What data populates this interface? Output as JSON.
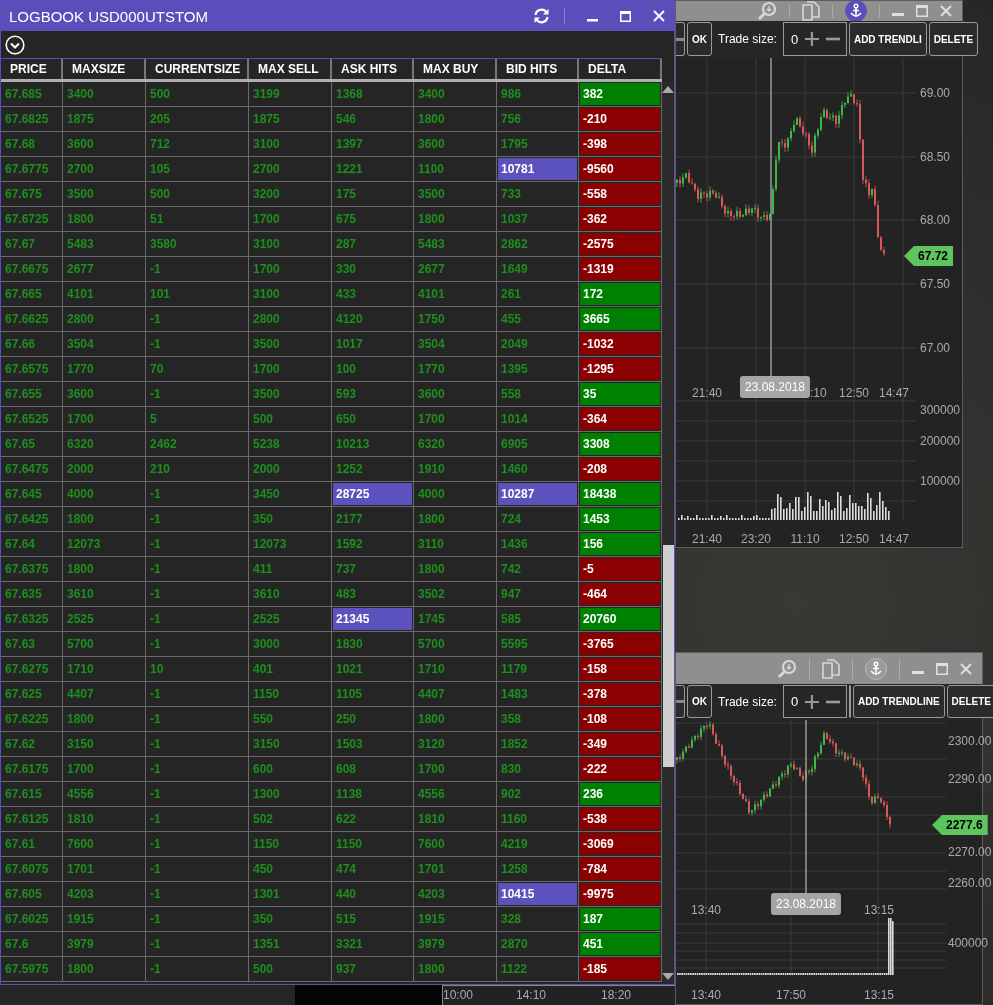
{
  "logbook": {
    "title": "LOGBOOK USD000UTSTOM",
    "columns": [
      "PRICE",
      "MAXSIZE",
      "CURRENTSIZE",
      "MAX SELL",
      "ASK HITS",
      "MAX BUY",
      "BID HITS",
      "DELTA"
    ],
    "rows": [
      {
        "price": "67.685",
        "maxsize": "3400",
        "currentsize": "500",
        "max_sell": "3199",
        "ask_hits": "1368",
        "ask_hits_highlighted": false,
        "max_buy": "3400",
        "bid_hits": "986",
        "bid_hits_highlighted": false,
        "delta": "382",
        "delta_positive": true
      },
      {
        "price": "67.6825",
        "maxsize": "1875",
        "currentsize": "205",
        "max_sell": "1875",
        "ask_hits": "546",
        "ask_hits_highlighted": false,
        "max_buy": "1800",
        "bid_hits": "756",
        "bid_hits_highlighted": false,
        "delta": "-210",
        "delta_positive": false
      },
      {
        "price": "67.68",
        "maxsize": "3600",
        "currentsize": "712",
        "max_sell": "3100",
        "ask_hits": "1397",
        "ask_hits_highlighted": false,
        "max_buy": "3600",
        "bid_hits": "1795",
        "bid_hits_highlighted": false,
        "delta": "-398",
        "delta_positive": false
      },
      {
        "price": "67.6775",
        "maxsize": "2700",
        "currentsize": "105",
        "max_sell": "2700",
        "ask_hits": "1221",
        "ask_hits_highlighted": false,
        "max_buy": "1100",
        "bid_hits": "10781",
        "bid_hits_highlighted": true,
        "delta": "-9560",
        "delta_positive": false
      },
      {
        "price": "67.675",
        "maxsize": "3500",
        "currentsize": "500",
        "max_sell": "3200",
        "ask_hits": "175",
        "ask_hits_highlighted": false,
        "max_buy": "3500",
        "bid_hits": "733",
        "bid_hits_highlighted": false,
        "delta": "-558",
        "delta_positive": false
      },
      {
        "price": "67.6725",
        "maxsize": "1800",
        "currentsize": "51",
        "max_sell": "1700",
        "ask_hits": "675",
        "ask_hits_highlighted": false,
        "max_buy": "1800",
        "bid_hits": "1037",
        "bid_hits_highlighted": false,
        "delta": "-362",
        "delta_positive": false
      },
      {
        "price": "67.67",
        "maxsize": "5483",
        "currentsize": "3580",
        "max_sell": "3100",
        "ask_hits": "287",
        "ask_hits_highlighted": false,
        "max_buy": "5483",
        "bid_hits": "2862",
        "bid_hits_highlighted": false,
        "delta": "-2575",
        "delta_positive": false
      },
      {
        "price": "67.6675",
        "maxsize": "2677",
        "currentsize": "-1",
        "max_sell": "1700",
        "ask_hits": "330",
        "ask_hits_highlighted": false,
        "max_buy": "2677",
        "bid_hits": "1649",
        "bid_hits_highlighted": false,
        "delta": "-1319",
        "delta_positive": false
      },
      {
        "price": "67.665",
        "maxsize": "4101",
        "currentsize": "101",
        "max_sell": "3100",
        "ask_hits": "433",
        "ask_hits_highlighted": false,
        "max_buy": "4101",
        "bid_hits": "261",
        "bid_hits_highlighted": false,
        "delta": "172",
        "delta_positive": true
      },
      {
        "price": "67.6625",
        "maxsize": "2800",
        "currentsize": "-1",
        "max_sell": "2800",
        "ask_hits": "4120",
        "ask_hits_highlighted": false,
        "max_buy": "1750",
        "bid_hits": "455",
        "bid_hits_highlighted": false,
        "delta": "3665",
        "delta_positive": true
      },
      {
        "price": "67.66",
        "maxsize": "3504",
        "currentsize": "-1",
        "max_sell": "3500",
        "ask_hits": "1017",
        "ask_hits_highlighted": false,
        "max_buy": "3504",
        "bid_hits": "2049",
        "bid_hits_highlighted": false,
        "delta": "-1032",
        "delta_positive": false
      },
      {
        "price": "67.6575",
        "maxsize": "1770",
        "currentsize": "70",
        "max_sell": "1700",
        "ask_hits": "100",
        "ask_hits_highlighted": false,
        "max_buy": "1770",
        "bid_hits": "1395",
        "bid_hits_highlighted": false,
        "delta": "-1295",
        "delta_positive": false
      },
      {
        "price": "67.655",
        "maxsize": "3600",
        "currentsize": "-1",
        "max_sell": "3500",
        "ask_hits": "593",
        "ask_hits_highlighted": false,
        "max_buy": "3600",
        "bid_hits": "558",
        "bid_hits_highlighted": false,
        "delta": "35",
        "delta_positive": true
      },
      {
        "price": "67.6525",
        "maxsize": "1700",
        "currentsize": "5",
        "max_sell": "500",
        "ask_hits": "650",
        "ask_hits_highlighted": false,
        "max_buy": "1700",
        "bid_hits": "1014",
        "bid_hits_highlighted": false,
        "delta": "-364",
        "delta_positive": false
      },
      {
        "price": "67.65",
        "maxsize": "6320",
        "currentsize": "2462",
        "max_sell": "5238",
        "ask_hits": "10213",
        "ask_hits_highlighted": false,
        "max_buy": "6320",
        "bid_hits": "6905",
        "bid_hits_highlighted": false,
        "delta": "3308",
        "delta_positive": true
      },
      {
        "price": "67.6475",
        "maxsize": "2000",
        "currentsize": "210",
        "max_sell": "2000",
        "ask_hits": "1252",
        "ask_hits_highlighted": false,
        "max_buy": "1910",
        "bid_hits": "1460",
        "bid_hits_highlighted": false,
        "delta": "-208",
        "delta_positive": false
      },
      {
        "price": "67.645",
        "maxsize": "4000",
        "currentsize": "-1",
        "max_sell": "3450",
        "ask_hits": "28725",
        "ask_hits_highlighted": true,
        "max_buy": "4000",
        "bid_hits": "10287",
        "bid_hits_highlighted": true,
        "delta": "18438",
        "delta_positive": true
      },
      {
        "price": "67.6425",
        "maxsize": "1800",
        "currentsize": "-1",
        "max_sell": "350",
        "ask_hits": "2177",
        "ask_hits_highlighted": false,
        "max_buy": "1800",
        "bid_hits": "724",
        "bid_hits_highlighted": false,
        "delta": "1453",
        "delta_positive": true
      },
      {
        "price": "67.64",
        "maxsize": "12073",
        "currentsize": "-1",
        "max_sell": "12073",
        "ask_hits": "1592",
        "ask_hits_highlighted": false,
        "max_buy": "3110",
        "bid_hits": "1436",
        "bid_hits_highlighted": false,
        "delta": "156",
        "delta_positive": true
      },
      {
        "price": "67.6375",
        "maxsize": "1800",
        "currentsize": "-1",
        "max_sell": "411",
        "ask_hits": "737",
        "ask_hits_highlighted": false,
        "max_buy": "1800",
        "bid_hits": "742",
        "bid_hits_highlighted": false,
        "delta": "-5",
        "delta_positive": false
      },
      {
        "price": "67.635",
        "maxsize": "3610",
        "currentsize": "-1",
        "max_sell": "3610",
        "ask_hits": "483",
        "ask_hits_highlighted": false,
        "max_buy": "3502",
        "bid_hits": "947",
        "bid_hits_highlighted": false,
        "delta": "-464",
        "delta_positive": false
      },
      {
        "price": "67.6325",
        "maxsize": "2525",
        "currentsize": "-1",
        "max_sell": "2525",
        "ask_hits": "21345",
        "ask_hits_highlighted": true,
        "max_buy": "1745",
        "bid_hits": "585",
        "bid_hits_highlighted": false,
        "delta": "20760",
        "delta_positive": true
      },
      {
        "price": "67.63",
        "maxsize": "5700",
        "currentsize": "-1",
        "max_sell": "3000",
        "ask_hits": "1830",
        "ask_hits_highlighted": false,
        "max_buy": "5700",
        "bid_hits": "5595",
        "bid_hits_highlighted": false,
        "delta": "-3765",
        "delta_positive": false
      },
      {
        "price": "67.6275",
        "maxsize": "1710",
        "currentsize": "10",
        "max_sell": "401",
        "ask_hits": "1021",
        "ask_hits_highlighted": false,
        "max_buy": "1710",
        "bid_hits": "1179",
        "bid_hits_highlighted": false,
        "delta": "-158",
        "delta_positive": false
      },
      {
        "price": "67.625",
        "maxsize": "4407",
        "currentsize": "-1",
        "max_sell": "1150",
        "ask_hits": "1105",
        "ask_hits_highlighted": false,
        "max_buy": "4407",
        "bid_hits": "1483",
        "bid_hits_highlighted": false,
        "delta": "-378",
        "delta_positive": false
      },
      {
        "price": "67.6225",
        "maxsize": "1800",
        "currentsize": "-1",
        "max_sell": "550",
        "ask_hits": "250",
        "ask_hits_highlighted": false,
        "max_buy": "1800",
        "bid_hits": "358",
        "bid_hits_highlighted": false,
        "delta": "-108",
        "delta_positive": false
      },
      {
        "price": "67.62",
        "maxsize": "3150",
        "currentsize": "-1",
        "max_sell": "3150",
        "ask_hits": "1503",
        "ask_hits_highlighted": false,
        "max_buy": "3120",
        "bid_hits": "1852",
        "bid_hits_highlighted": false,
        "delta": "-349",
        "delta_positive": false
      },
      {
        "price": "67.6175",
        "maxsize": "1700",
        "currentsize": "-1",
        "max_sell": "600",
        "ask_hits": "608",
        "ask_hits_highlighted": false,
        "max_buy": "1700",
        "bid_hits": "830",
        "bid_hits_highlighted": false,
        "delta": "-222",
        "delta_positive": false
      },
      {
        "price": "67.615",
        "maxsize": "4556",
        "currentsize": "-1",
        "max_sell": "1300",
        "ask_hits": "1138",
        "ask_hits_highlighted": false,
        "max_buy": "4556",
        "bid_hits": "902",
        "bid_hits_highlighted": false,
        "delta": "236",
        "delta_positive": true
      },
      {
        "price": "67.6125",
        "maxsize": "1810",
        "currentsize": "-1",
        "max_sell": "502",
        "ask_hits": "622",
        "ask_hits_highlighted": false,
        "max_buy": "1810",
        "bid_hits": "1160",
        "bid_hits_highlighted": false,
        "delta": "-538",
        "delta_positive": false
      },
      {
        "price": "67.61",
        "maxsize": "7600",
        "currentsize": "-1",
        "max_sell": "1150",
        "ask_hits": "1150",
        "ask_hits_highlighted": false,
        "max_buy": "7600",
        "bid_hits": "4219",
        "bid_hits_highlighted": false,
        "delta": "-3069",
        "delta_positive": false
      },
      {
        "price": "67.6075",
        "maxsize": "1701",
        "currentsize": "-1",
        "max_sell": "450",
        "ask_hits": "474",
        "ask_hits_highlighted": false,
        "max_buy": "1701",
        "bid_hits": "1258",
        "bid_hits_highlighted": false,
        "delta": "-784",
        "delta_positive": false
      },
      {
        "price": "67.605",
        "maxsize": "4203",
        "currentsize": "-1",
        "max_sell": "1301",
        "ask_hits": "440",
        "ask_hits_highlighted": false,
        "max_buy": "4203",
        "bid_hits": "10415",
        "bid_hits_highlighted": true,
        "delta": "-9975",
        "delta_positive": false
      },
      {
        "price": "67.6025",
        "maxsize": "1915",
        "currentsize": "-1",
        "max_sell": "350",
        "ask_hits": "515",
        "ask_hits_highlighted": false,
        "max_buy": "1915",
        "bid_hits": "328",
        "bid_hits_highlighted": false,
        "delta": "187",
        "delta_positive": true
      },
      {
        "price": "67.6",
        "maxsize": "3979",
        "currentsize": "-1",
        "max_sell": "1351",
        "ask_hits": "3321",
        "ask_hits_highlighted": false,
        "max_buy": "3979",
        "bid_hits": "2870",
        "bid_hits_highlighted": false,
        "delta": "451",
        "delta_positive": true
      },
      {
        "price": "67.5975",
        "maxsize": "1800",
        "currentsize": "-1",
        "max_sell": "500",
        "ask_hits": "937",
        "ask_hits_highlighted": false,
        "max_buy": "1800",
        "bid_hits": "1122",
        "bid_hits_highlighted": false,
        "delta": "-185",
        "delta_positive": false
      }
    ]
  },
  "charts": [
    {
      "anchor_active": true,
      "ok": "OK",
      "trade_size_label": "Trade size:",
      "trade_size": "0",
      "buttons": [
        {
          "kind": "text",
          "label": "ADD TRENDLI"
        },
        {
          "kind": "text",
          "label": "DELETE"
        }
      ],
      "price_labels": [
        "69.00",
        "68.50",
        "68.00",
        "67.50",
        "67.00"
      ],
      "last_price": "67.72",
      "time_labels": [
        "21:40",
        ":10",
        "12:50",
        "14:47"
      ],
      "crosshair_date": "23.08.2018",
      "volume_labels": [
        "300000",
        "200000",
        "100000"
      ],
      "volume_time_labels": [
        "21:40",
        "23:20",
        "11:10",
        "12:50",
        "14:47"
      ]
    },
    {
      "anchor_active": false,
      "ok": "OK",
      "trade_size_label": "Trade size:",
      "trade_size": "0",
      "buttons": [
        {
          "kind": "blank"
        },
        {
          "kind": "text",
          "label": "ADD TRENDLINE"
        },
        {
          "kind": "text",
          "label": "DELETE"
        }
      ],
      "price_labels": [
        "2300.00",
        "2290.00",
        "2270.00",
        "2260.00"
      ],
      "last_price": "2277.6",
      "time_labels": [
        "13:40",
        "13:15"
      ],
      "crosshair_date": "23.08.2018",
      "volume_labels": [
        "400000"
      ],
      "volume_time_labels": [
        "13:40",
        "17:50",
        "13:15"
      ]
    }
  ],
  "bottom_axis": {
    "labels": [
      "10:00",
      "14:10",
      "18:20"
    ]
  }
}
